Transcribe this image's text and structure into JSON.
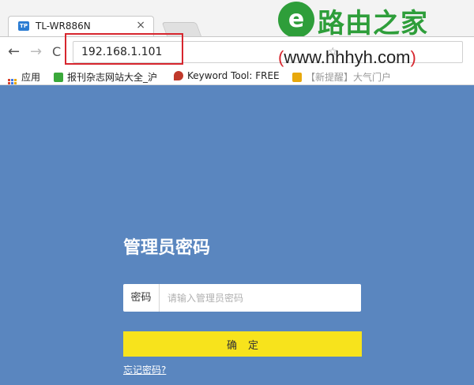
{
  "browser": {
    "tab": {
      "favicon_text": "TP",
      "title": "TL-WR886N",
      "close_symbol": "×"
    },
    "nav": {
      "back_symbol": "←",
      "forward_symbol": "→",
      "reload_symbol": "C"
    },
    "address": {
      "url": "192.168.1.101"
    },
    "bookmarks": [
      {
        "label": "应用",
        "icon": "apps-grid-icon"
      },
      {
        "label": "报刊杂志网站大全_沪",
        "icon": "green-check-icon",
        "color": "#3aa83a"
      },
      {
        "label": "Keyword Tool: FREE",
        "icon": "flame-icon",
        "color": "#c0392b"
      },
      {
        "label": "【新提醒】大气门户",
        "icon": "page-icon",
        "color": "#e8a80c"
      }
    ]
  },
  "watermark": {
    "logo_glyph": "e",
    "title": "路由之家",
    "url_open": "(",
    "url_text": "www.hhhyh.com",
    "url_close": ")"
  },
  "login": {
    "title": "管理员密码",
    "password_label": "密码",
    "password_placeholder": "请输入管理员密码",
    "confirm_label": "确定",
    "forgot_label": "忘记密码?"
  },
  "colors": {
    "page_background": "#5a86bf",
    "confirm_button": "#f7e31c",
    "highlight_border": "#d7262e",
    "watermark_green": "#2e9e3a"
  }
}
